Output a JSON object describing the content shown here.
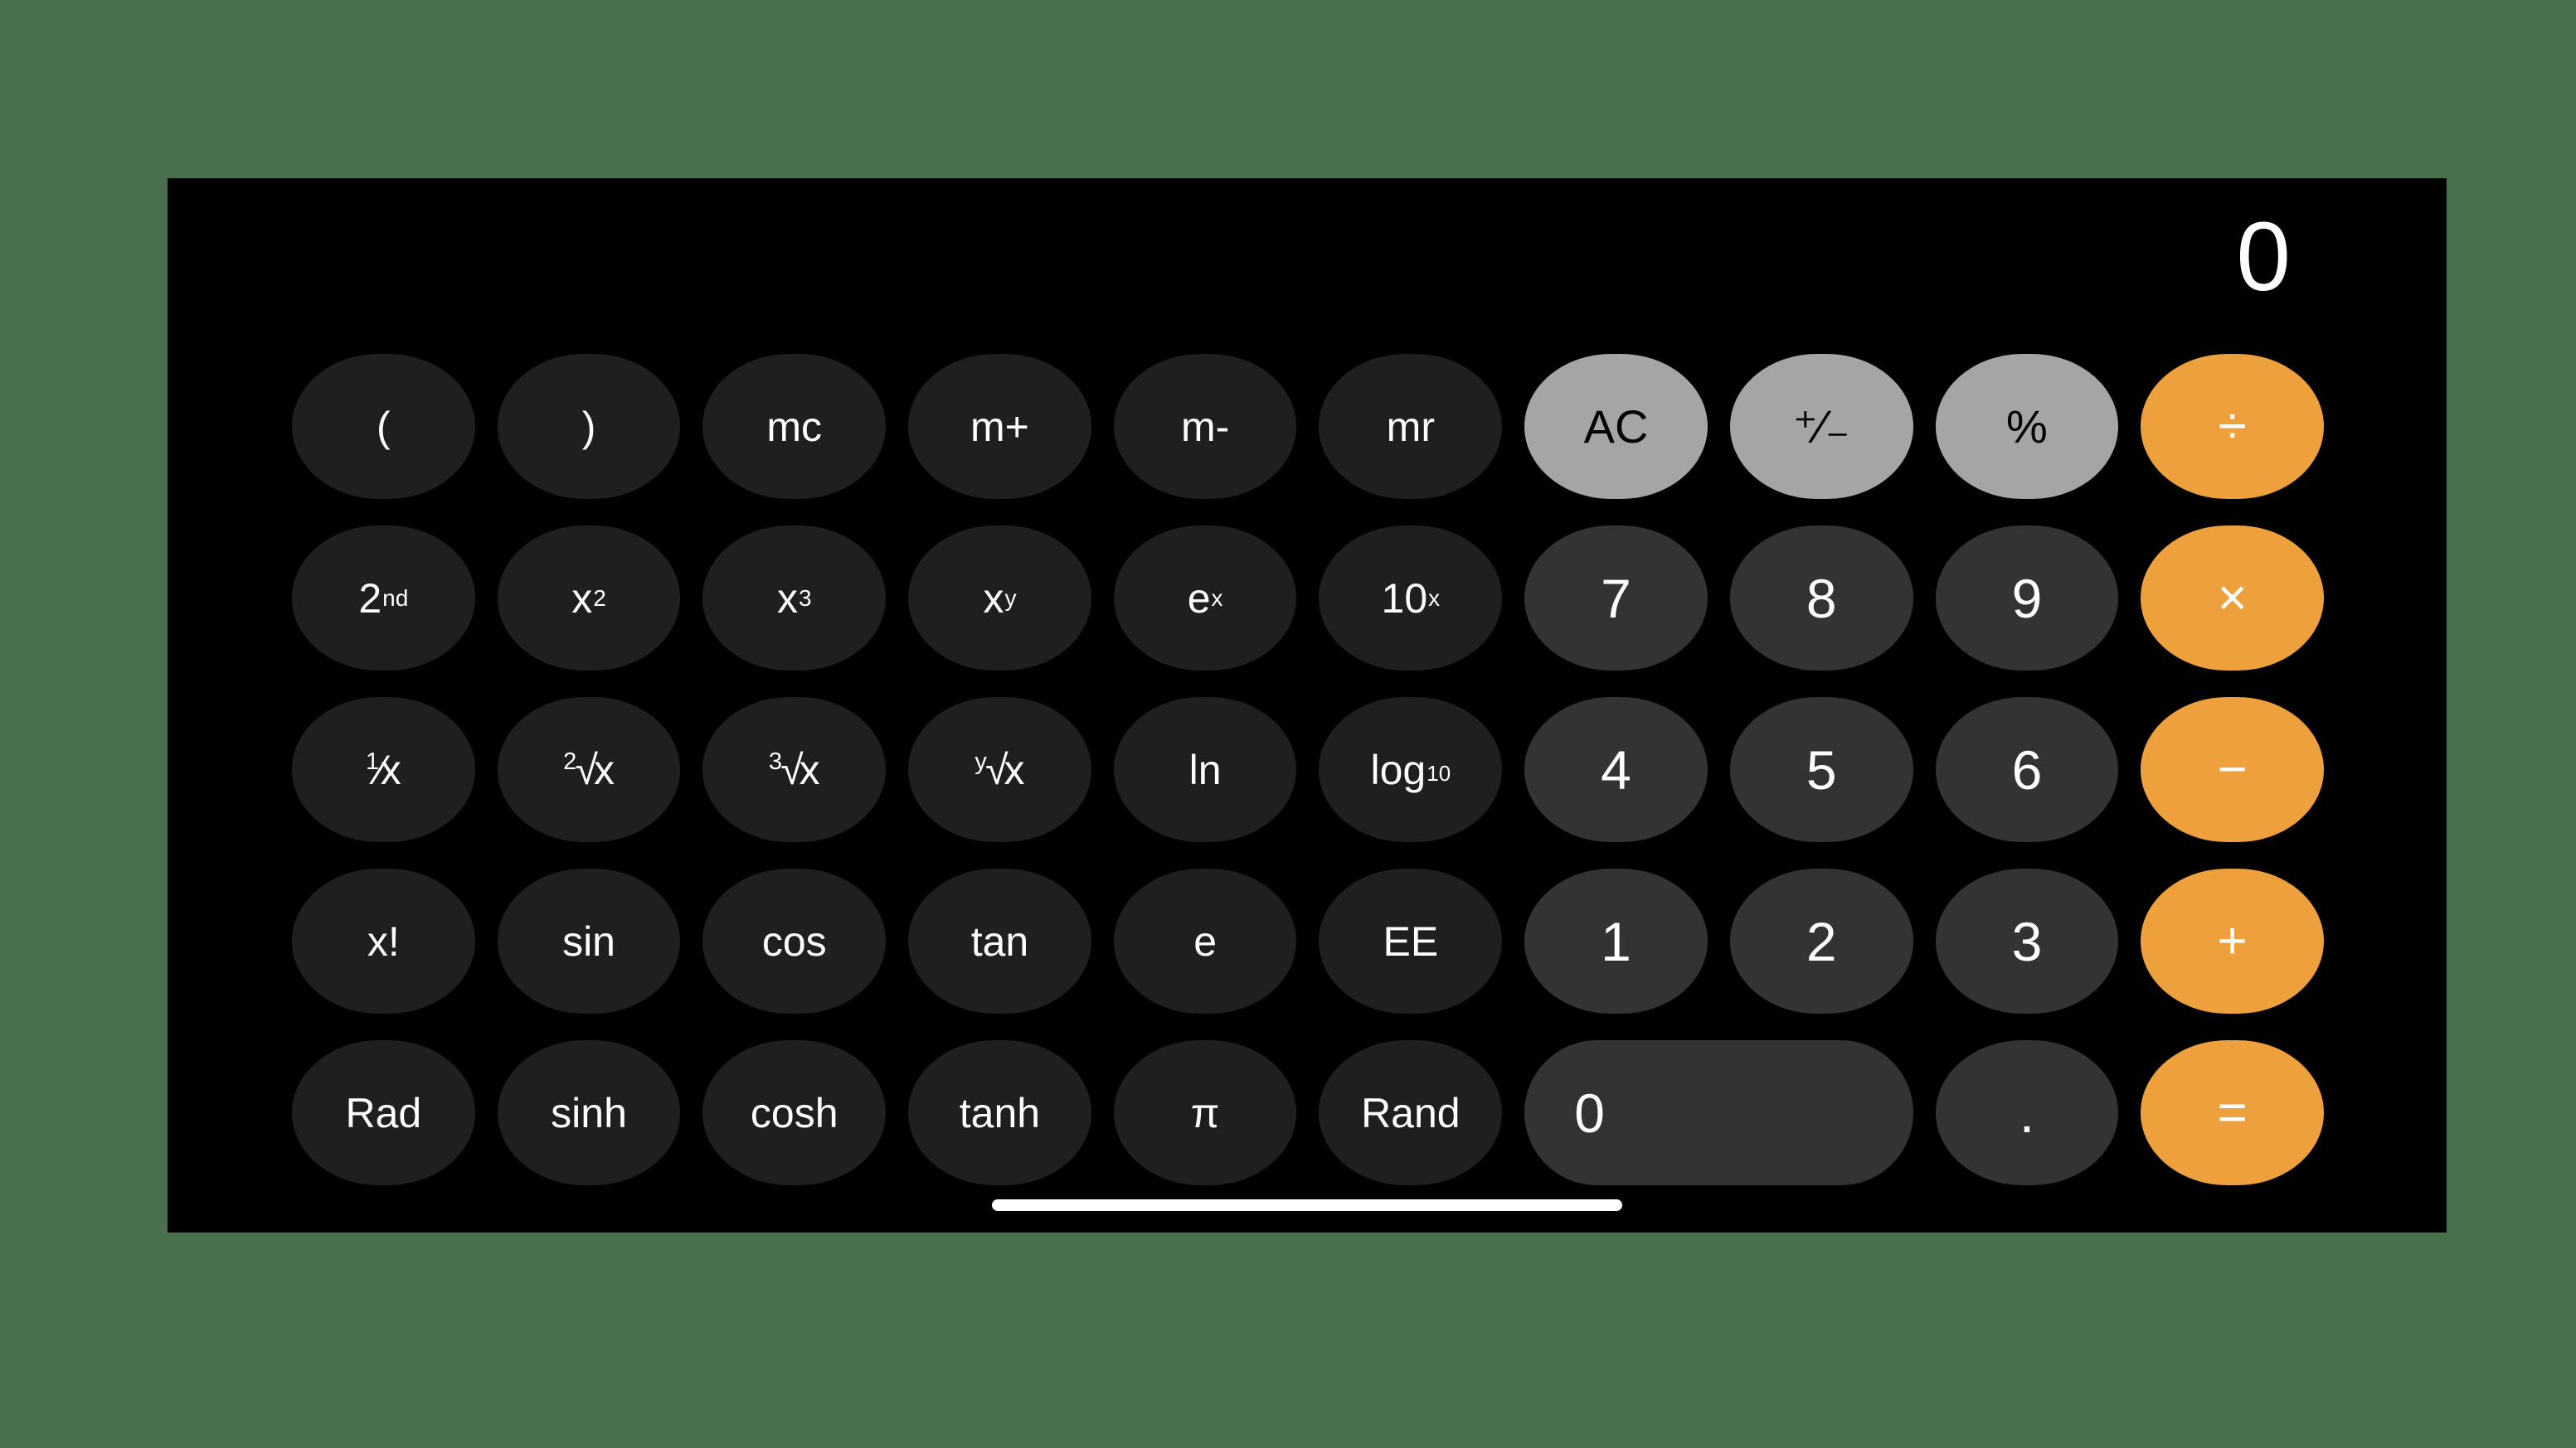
{
  "app": {
    "name": "Calculator",
    "mode": "scientific",
    "orientation": "landscape"
  },
  "theme": {
    "page_background": "#48704c",
    "panel_background": "#000000",
    "function_key": "#1f1f1f",
    "utility_key": "#a5a5a5",
    "digit_key": "#333333",
    "operator_key": "#eda03c",
    "text_light": "#ffffff",
    "text_dark": "#000000"
  },
  "display": {
    "value": "0"
  },
  "home_indicator": {
    "label": "home-indicator"
  },
  "keypad": {
    "columns": 10,
    "rows": [
      {
        "keys": [
          {
            "label": "(",
            "name": "open-paren-key",
            "style": "fn",
            "span": 1
          },
          {
            "label": ")",
            "name": "close-paren-key",
            "style": "fn",
            "span": 1
          },
          {
            "label": "mc",
            "name": "memory-clear-key",
            "style": "fn",
            "span": 1
          },
          {
            "label": "m+",
            "name": "memory-add-key",
            "style": "fn",
            "span": 1
          },
          {
            "label": "m-",
            "name": "memory-subtract-key",
            "style": "fn",
            "span": 1
          },
          {
            "label": "mr",
            "name": "memory-recall-key",
            "style": "fn",
            "span": 1
          },
          {
            "label": "AC",
            "name": "all-clear-key",
            "style": "util",
            "span": 1
          },
          {
            "label": "⁺⁄₋",
            "name": "plus-minus-key",
            "style": "util",
            "span": 1
          },
          {
            "label": "%",
            "name": "percent-key",
            "style": "util",
            "span": 1
          },
          {
            "label": "÷",
            "name": "divide-key",
            "style": "op",
            "span": 1
          }
        ]
      },
      {
        "keys": [
          {
            "label": "2nd",
            "name": "second-function-key",
            "style": "fn",
            "span": 1,
            "html": "2<sup>nd</sup>"
          },
          {
            "label": "x²",
            "name": "x-squared-key",
            "style": "fn",
            "span": 1,
            "html": "x<sup>2</sup>"
          },
          {
            "label": "x³",
            "name": "x-cubed-key",
            "style": "fn",
            "span": 1,
            "html": "x<sup>3</sup>"
          },
          {
            "label": "xʸ",
            "name": "x-to-power-y-key",
            "style": "fn",
            "span": 1,
            "html": "x<sup>y</sup>"
          },
          {
            "label": "eˣ",
            "name": "e-to-power-x-key",
            "style": "fn",
            "span": 1,
            "html": "e<sup>x</sup>"
          },
          {
            "label": "10ˣ",
            "name": "ten-to-power-x-key",
            "style": "fn",
            "span": 1,
            "html": "10<sup>x</sup>"
          },
          {
            "label": "7",
            "name": "digit-7-key",
            "style": "digit",
            "span": 1
          },
          {
            "label": "8",
            "name": "digit-8-key",
            "style": "digit",
            "span": 1
          },
          {
            "label": "9",
            "name": "digit-9-key",
            "style": "digit",
            "span": 1
          },
          {
            "label": "×",
            "name": "multiply-key",
            "style": "op",
            "span": 1
          }
        ]
      },
      {
        "keys": [
          {
            "label": "1/x",
            "name": "reciprocal-key",
            "style": "fn",
            "span": 1,
            "html": "<span class=\"radical\"><span class=\"index\">1</span><span class=\"rad\">⁄</span><span class=\"rand\">x</span></span>"
          },
          {
            "label": "²√x",
            "name": "square-root-key",
            "style": "fn",
            "span": 1,
            "html": "<span class=\"radical\"><span class=\"index\">2</span><span class=\"rad\">√</span><span class=\"rand\">x</span></span>"
          },
          {
            "label": "³√x",
            "name": "cube-root-key",
            "style": "fn",
            "span": 1,
            "html": "<span class=\"radical\"><span class=\"index\">3</span><span class=\"rad\">√</span><span class=\"rand\">x</span></span>"
          },
          {
            "label": "ʸ√x",
            "name": "y-root-key",
            "style": "fn",
            "span": 1,
            "html": "<span class=\"radical\"><span class=\"index\">y</span><span class=\"rad\">√</span><span class=\"rand\">x</span></span>"
          },
          {
            "label": "ln",
            "name": "natural-log-key",
            "style": "fn",
            "span": 1
          },
          {
            "label": "log10",
            "name": "log-base-10-key",
            "style": "fn",
            "span": 1,
            "html": "log<sub>10</sub>"
          },
          {
            "label": "4",
            "name": "digit-4-key",
            "style": "digit",
            "span": 1
          },
          {
            "label": "5",
            "name": "digit-5-key",
            "style": "digit",
            "span": 1
          },
          {
            "label": "6",
            "name": "digit-6-key",
            "style": "digit",
            "span": 1
          },
          {
            "label": "−",
            "name": "subtract-key",
            "style": "op",
            "span": 1
          }
        ]
      },
      {
        "keys": [
          {
            "label": "x!",
            "name": "factorial-key",
            "style": "fn",
            "span": 1
          },
          {
            "label": "sin",
            "name": "sine-key",
            "style": "fn",
            "span": 1
          },
          {
            "label": "cos",
            "name": "cosine-key",
            "style": "fn",
            "span": 1
          },
          {
            "label": "tan",
            "name": "tangent-key",
            "style": "fn",
            "span": 1
          },
          {
            "label": "e",
            "name": "euler-constant-key",
            "style": "fn",
            "span": 1
          },
          {
            "label": "EE",
            "name": "exponent-entry-key",
            "style": "fn",
            "span": 1
          },
          {
            "label": "1",
            "name": "digit-1-key",
            "style": "digit",
            "span": 1
          },
          {
            "label": "2",
            "name": "digit-2-key",
            "style": "digit",
            "span": 1
          },
          {
            "label": "3",
            "name": "digit-3-key",
            "style": "digit",
            "span": 1
          },
          {
            "label": "+",
            "name": "add-key",
            "style": "op",
            "span": 1
          }
        ]
      },
      {
        "keys": [
          {
            "label": "Rad",
            "name": "radians-toggle-key",
            "style": "fn",
            "span": 1
          },
          {
            "label": "sinh",
            "name": "hyperbolic-sine-key",
            "style": "fn",
            "span": 1
          },
          {
            "label": "cosh",
            "name": "hyperbolic-cosine-key",
            "style": "fn",
            "span": 1
          },
          {
            "label": "tanh",
            "name": "hyperbolic-tangent-key",
            "style": "fn",
            "span": 1
          },
          {
            "label": "π",
            "name": "pi-key",
            "style": "fn",
            "span": 1
          },
          {
            "label": "Rand",
            "name": "random-key",
            "style": "fn",
            "span": 1
          },
          {
            "label": "0",
            "name": "digit-0-key",
            "style": "digit",
            "span": 2
          },
          {
            "label": ".",
            "name": "decimal-point-key",
            "style": "digit",
            "span": 1
          },
          {
            "label": "=",
            "name": "equals-key",
            "style": "op",
            "span": 1
          }
        ]
      }
    ]
  }
}
